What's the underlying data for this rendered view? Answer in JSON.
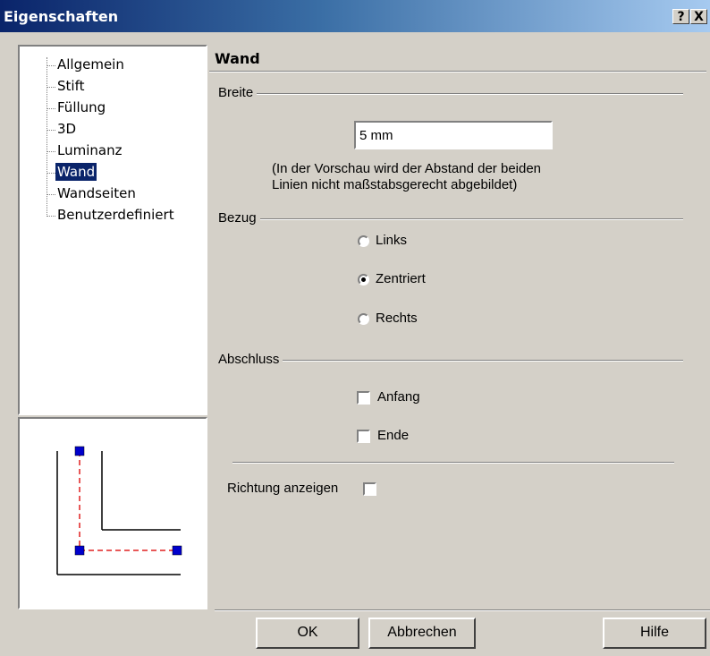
{
  "window": {
    "title": "Eigenschaften",
    "help_btn": "?",
    "close_btn": "X"
  },
  "tree": {
    "items": [
      {
        "label": "Allgemein"
      },
      {
        "label": "Stift"
      },
      {
        "label": "Füllung"
      },
      {
        "label": "3D"
      },
      {
        "label": "Luminanz"
      },
      {
        "label": "Wand",
        "selected": true
      },
      {
        "label": "Wandseiten"
      },
      {
        "label": "Benutzerdefiniert"
      }
    ]
  },
  "panel": {
    "title": "Wand",
    "breite": {
      "label": "Breite",
      "value": "5 mm",
      "note_line1": "(In der Vorschau wird der Abstand der beiden",
      "note_line2": "Linien nicht maßstabsgerecht abgebildet)"
    },
    "bezug": {
      "label": "Bezug",
      "options": [
        "Links",
        "Zentriert",
        "Rechts"
      ],
      "selected": "Zentriert"
    },
    "abschluss": {
      "label": "Abschluss",
      "anfang": {
        "label": "Anfang",
        "checked": false
      },
      "ende": {
        "label": "Ende",
        "checked": false
      }
    },
    "richtung": {
      "label": "Richtung anzeigen",
      "checked": false
    }
  },
  "buttons": {
    "ok": "OK",
    "cancel": "Abbrechen",
    "help": "Hilfe"
  },
  "colors": {
    "titlebar_start": "#0a246a",
    "selection": "#0a246a",
    "preview_dash": "#e02020",
    "preview_handle": "#0000cc"
  }
}
